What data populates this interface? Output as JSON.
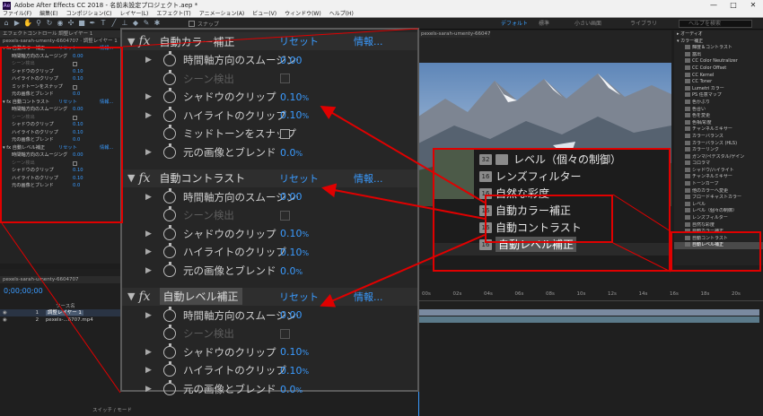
{
  "app": {
    "title": "Adobe After Effects CC 2018 - 名前未設定プロジェクト.aep *",
    "logo": "Ae",
    "window_buttons": [
      "—",
      "□",
      "✕"
    ]
  },
  "menu": [
    "ファイル(F)",
    "編集(E)",
    "コンポジション(C)",
    "レイヤー(L)",
    "エフェクト(T)",
    "アニメーション(A)",
    "ビュー(V)",
    "ウィンドウ(W)",
    "ヘルプ(H)"
  ],
  "toolbar": {
    "snap_label": "スナップ",
    "workspaces": [
      "デフォルト",
      "標準",
      "小さい画面",
      "ライブラリ"
    ],
    "help_search_placeholder": "ヘルプを検索"
  },
  "effect_controls": {
    "tab": "エフェクトコントロール 調整レイヤー 1",
    "layer_path": "pexels-sarah-umenty-6604707 · 調整レイヤー 1",
    "groups": [
      {
        "name": "自動カラー補正",
        "reset": "リセット",
        "info": "情報...",
        "props": [
          {
            "name": "時間軸方向のスムージング",
            "value": "0.00",
            "kind": "value"
          },
          {
            "name": "シーン検出",
            "value": "",
            "kind": "checkbox",
            "disabled": true
          },
          {
            "name": "シャドウのクリップ",
            "value": "0.10",
            "unit": "%",
            "kind": "value"
          },
          {
            "name": "ハイライトのクリップ",
            "value": "0.10",
            "unit": "%",
            "kind": "value"
          },
          {
            "name": "ミッドトーンをスナップ",
            "value": "",
            "kind": "checkbox"
          },
          {
            "name": "元の画像とブレンド",
            "value": "0.0",
            "unit": "%",
            "kind": "value"
          }
        ]
      },
      {
        "name": "自動コントラスト",
        "reset": "リセット",
        "info": "情報...",
        "props": [
          {
            "name": "時間軸方向のスムージング",
            "value": "0.00",
            "kind": "value"
          },
          {
            "name": "シーン検出",
            "value": "",
            "kind": "checkbox",
            "disabled": true
          },
          {
            "name": "シャドウのクリップ",
            "value": "0.10",
            "unit": "%",
            "kind": "value"
          },
          {
            "name": "ハイライトのクリップ",
            "value": "0.10",
            "unit": "%",
            "kind": "value"
          },
          {
            "name": "元の画像とブレンド",
            "value": "0.0",
            "unit": "%",
            "kind": "value"
          }
        ]
      },
      {
        "name": "自動レベル補正",
        "reset": "リセット",
        "info": "情報...",
        "props": [
          {
            "name": "時間軸方向のスムージング",
            "value": "0.00",
            "kind": "value"
          },
          {
            "name": "シーン検出",
            "value": "",
            "kind": "checkbox",
            "disabled": true
          },
          {
            "name": "シャドウのクリップ",
            "value": "0.10",
            "unit": "%",
            "kind": "value"
          },
          {
            "name": "ハイライトのクリップ",
            "value": "0.10",
            "unit": "%",
            "kind": "value"
          },
          {
            "name": "元の画像とブレンド",
            "value": "0.0",
            "unit": "%",
            "kind": "value"
          }
        ]
      }
    ]
  },
  "composition": {
    "tab": "pexels-sarah-umenty-6604707"
  },
  "effect_menu_zoom": {
    "items": [
      "レベル（個々の制御）",
      "レンズフィルター",
      "自然な彩度",
      "自動カラー補正",
      "自動コントラスト",
      "自動レベル補正"
    ],
    "highlighted": "自動レベル補正"
  },
  "effects_presets": {
    "items": [
      "▸ オーディオ",
      "▾ カラー補正",
      "輝度＆コントラスト",
      "露出",
      "CC Color Neutralizer",
      "CC Color Offset",
      "CC Kernel",
      "CC Toner",
      "Lumetri カラー",
      "PS 任意マップ",
      "色かぶり",
      "色合い",
      "色を変更",
      "色相/彩度",
      "チャンネルミキサー",
      "カラーバランス",
      "カラーバランス (HLS)",
      "カラーリンク",
      "ガンマ/ペデスタル/ゲイン",
      "コロラマ",
      "シャドウ/ハイライト",
      "チャンネルミキサー",
      "トーンカーブ",
      "他のカラーへ変更",
      "ブロードキャストカラー",
      "レベル",
      "レベル（個々の制御）",
      "レンズフィルター",
      "自然な彩度",
      "自動カラー補正",
      "自動コントラスト",
      "自動レベル補正"
    ]
  },
  "timeline": {
    "tab": "pexels-sarah-umenty-6604707",
    "timecode": "0;00;00;00",
    "column_header": "ソース名",
    "layers": [
      {
        "num": "1",
        "name": "調整レイヤー 1"
      },
      {
        "num": "2",
        "name": "pexels-...6707.mp4"
      }
    ],
    "ticks": [
      "00s",
      "02s",
      "04s",
      "06s",
      "08s",
      "10s",
      "12s",
      "14s",
      "16s",
      "18s",
      "20s"
    ],
    "footer": "スイッチ / モード"
  }
}
